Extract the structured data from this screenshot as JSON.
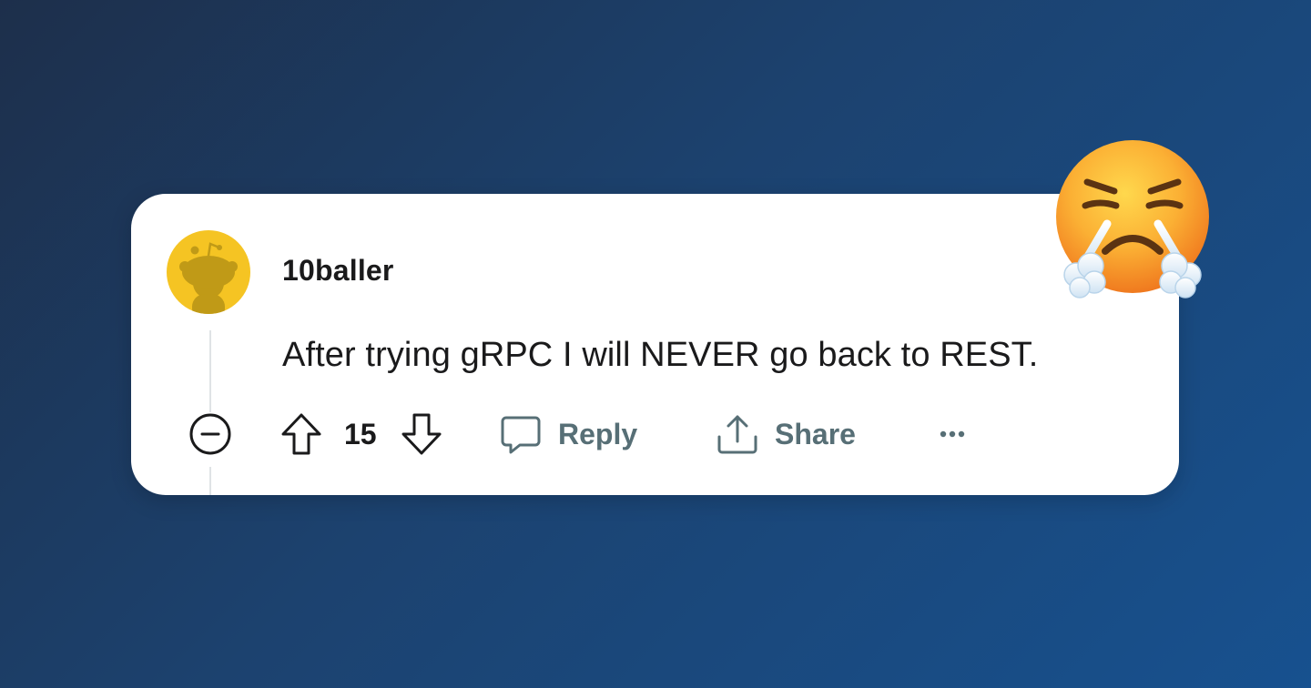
{
  "comment": {
    "username": "10baller",
    "body": "After trying gRPC I will NEVER go back to REST.",
    "vote_count": "15"
  },
  "actions": {
    "reply_label": "Reply",
    "share_label": "Share"
  },
  "icons": {
    "avatar": "snoo-avatar-icon",
    "collapse": "collapse-minus-icon",
    "upvote": "upvote-arrow-icon",
    "downvote": "downvote-arrow-icon",
    "reply": "speech-bubble-icon",
    "share": "share-upload-icon",
    "more": "ellipsis-icon",
    "reaction": "face-with-steam-from-nose-emoji"
  },
  "colors": {
    "background": "#1c426f",
    "card": "#ffffff",
    "avatar_bg": "#f5c423",
    "text_primary": "#1a1a1b",
    "text_secondary": "#576f76"
  }
}
